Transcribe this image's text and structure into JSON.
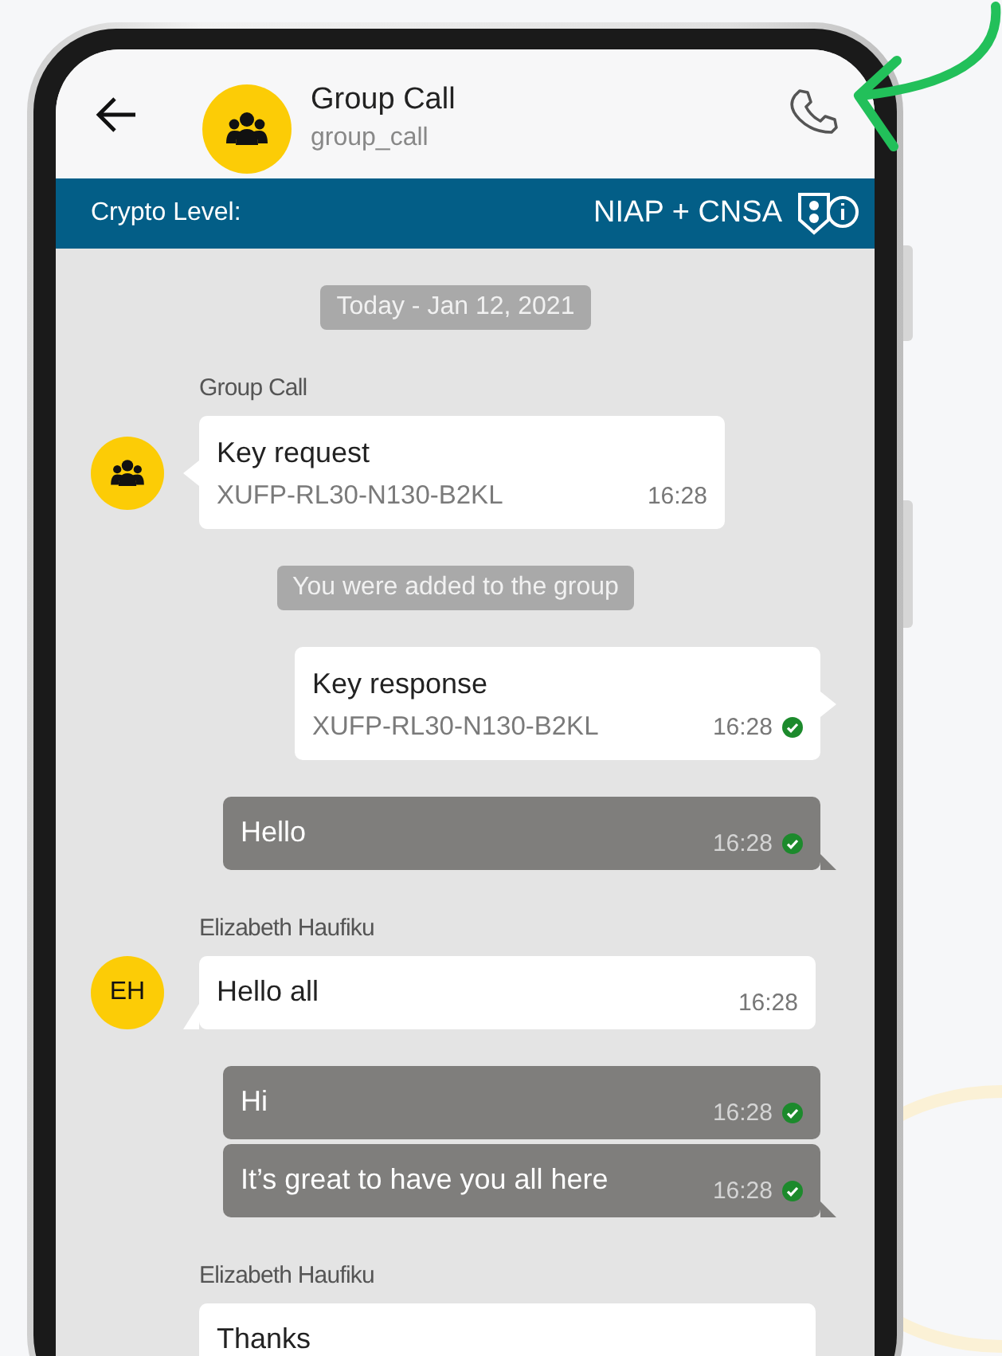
{
  "header": {
    "title": "Group Call",
    "subtitle": "group_call"
  },
  "crypto_bar": {
    "label": "Crypto Level:",
    "value": "NIAP + CNSA"
  },
  "messages": [
    {
      "kind": "date",
      "text": "Today - Jan 12, 2021"
    },
    {
      "kind": "incoming",
      "sender": "Group Call",
      "avatar": {
        "kind": "group"
      },
      "text": "Key request",
      "code": "XUFP-RL30-N130-B2KL",
      "time": "16:28"
    },
    {
      "kind": "system",
      "text": "You were added to the group"
    },
    {
      "kind": "outgoing",
      "text": "Key response",
      "code": "XUFP-RL30-N130-B2KL",
      "time": "16:28",
      "delivered": true
    },
    {
      "kind": "outgoing",
      "text": "Hello",
      "time": "16:28",
      "delivered": true
    },
    {
      "kind": "incoming",
      "sender": "Elizabeth Haufiku",
      "avatar": {
        "kind": "initials",
        "text": "EH"
      },
      "text": "Hello all",
      "time": "16:28"
    },
    {
      "kind": "outgoing",
      "text": "Hi",
      "time": "16:28",
      "delivered": true
    },
    {
      "kind": "outgoing",
      "text": "It’s great to have you all here",
      "time": "16:28",
      "delivered": true
    },
    {
      "kind": "incoming",
      "sender": "Elizabeth Haufiku",
      "text": "Thanks"
    }
  ]
}
